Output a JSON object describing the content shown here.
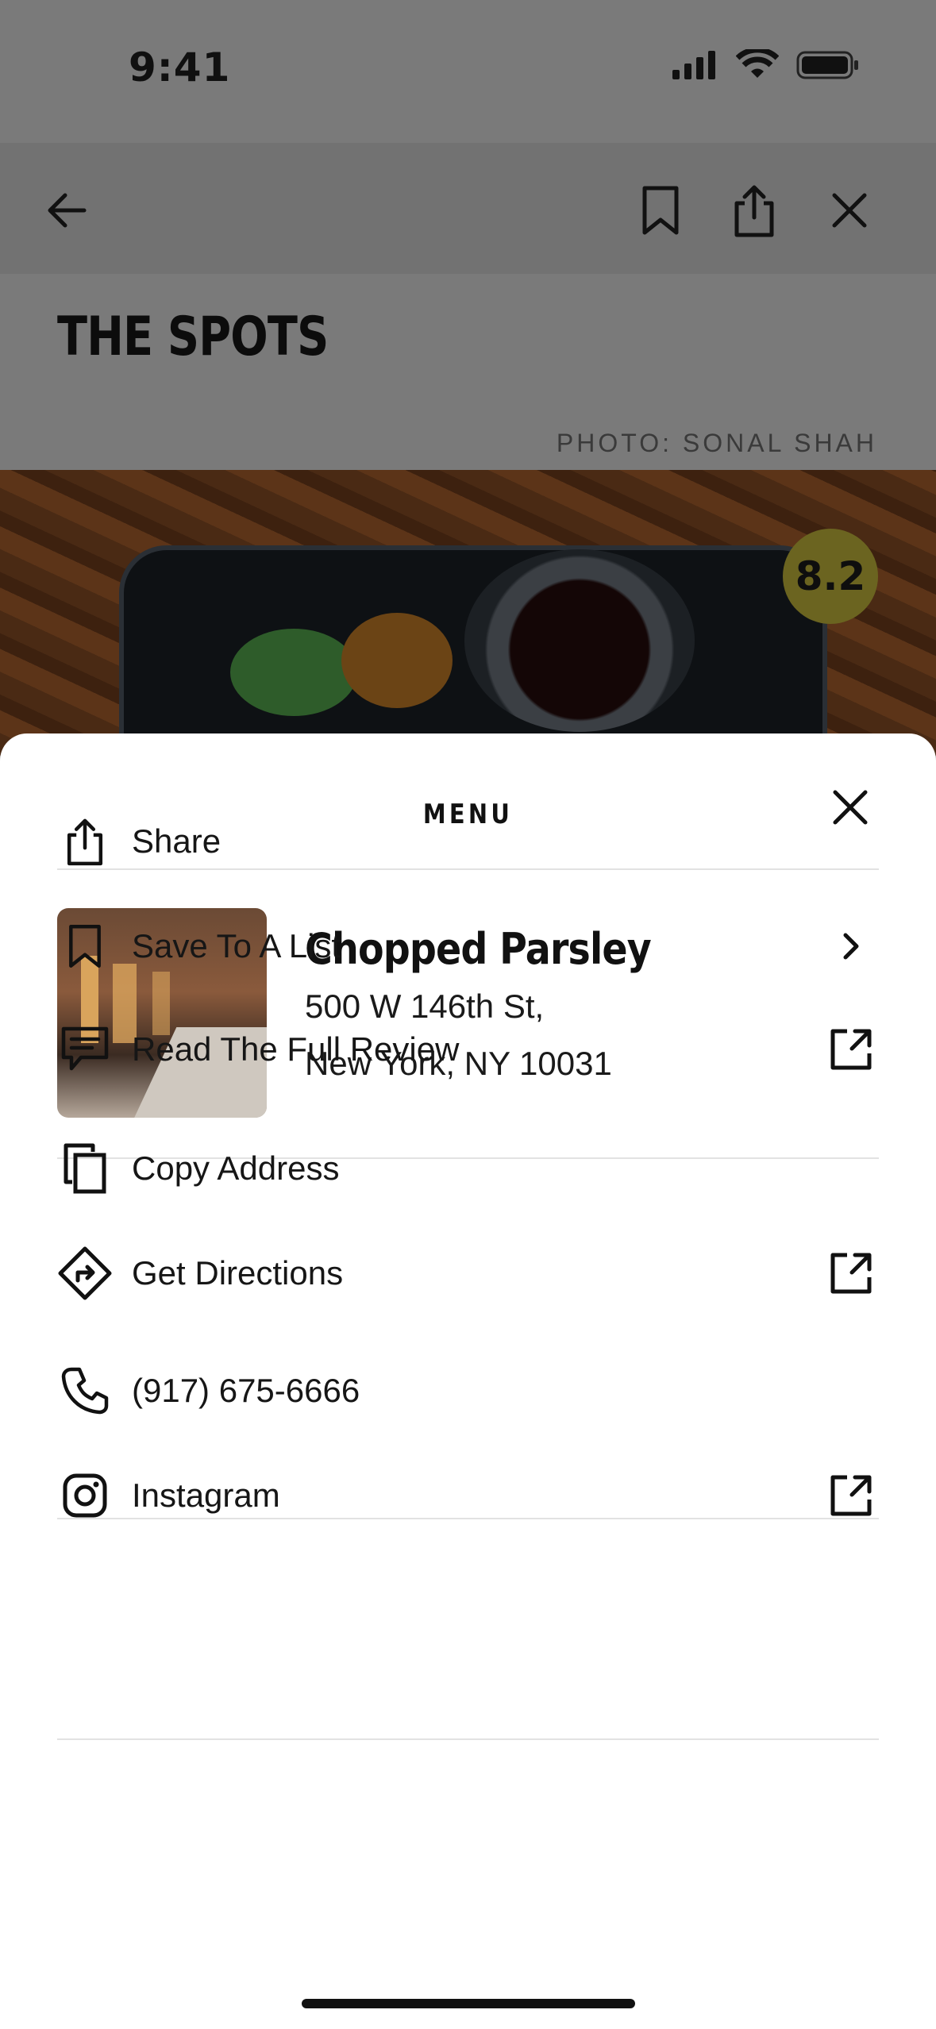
{
  "status_bar": {
    "time": "9:41"
  },
  "header": {
    "title": "THE SPOTS",
    "photo_credit": "PHOTO: SONAL SHAH",
    "rating": "8.2"
  },
  "sheet": {
    "title": "MENU",
    "place": {
      "name": "Chopped Parsley",
      "address_line1": "500 W 146th St,",
      "address_line2": "New York, NY 10031"
    },
    "items": [
      {
        "label": "Share",
        "icon": "share-icon",
        "trailing": ""
      },
      {
        "label": "Save To A List",
        "icon": "bookmark-icon",
        "trailing": "chevron-right-icon"
      },
      {
        "label": "Read The Full Review",
        "icon": "chat-icon",
        "trailing": "external-link-icon"
      },
      {
        "label": "Copy Address",
        "icon": "copy-icon",
        "trailing": ""
      },
      {
        "label": "Get Directions",
        "icon": "directions-icon",
        "trailing": "external-link-icon"
      },
      {
        "label": "(917) 675-6666",
        "icon": "phone-icon",
        "trailing": ""
      },
      {
        "label": "Instagram",
        "icon": "instagram-icon",
        "trailing": "external-link-icon"
      }
    ]
  }
}
